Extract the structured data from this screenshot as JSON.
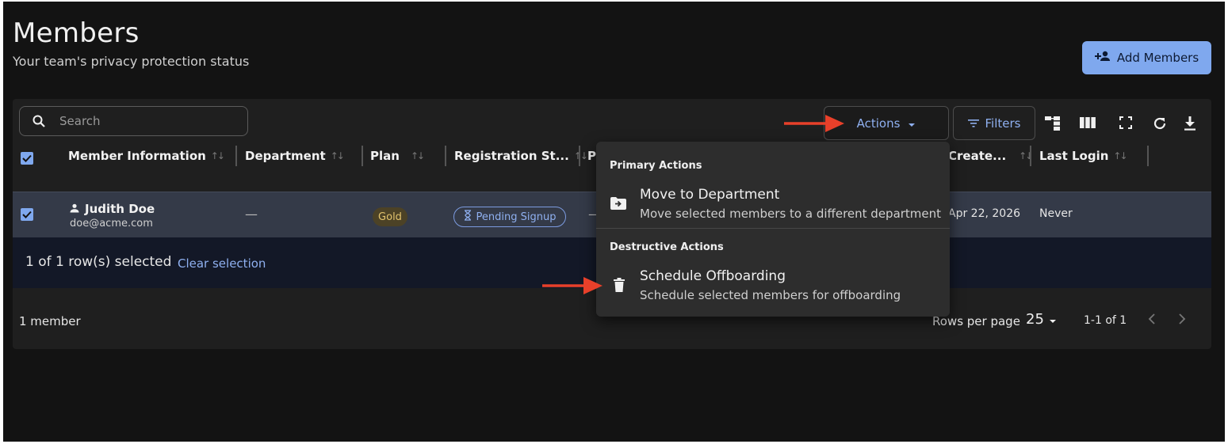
{
  "header": {
    "title": "Members",
    "subtitle": "Your team's privacy protection status",
    "add_button": "Add Members"
  },
  "toolbar": {
    "search_placeholder": "Search",
    "actions_label": "Actions",
    "filters_label": "Filters"
  },
  "columns": [
    "Member Information",
    "Department",
    "Plan",
    "Registration St...",
    "P",
    "Create...",
    "Last Login"
  ],
  "row": {
    "name": "Judith Doe",
    "email": "doe@acme.com",
    "department": "—",
    "plan": "Gold",
    "registration_status": "Pending Signup",
    "p_value": "—",
    "created": "Apr 22, 2026",
    "last_login": "Never",
    "selected": true
  },
  "selection": {
    "text": "1 of 1 row(s) selected",
    "clear_label": "Clear selection"
  },
  "footer": {
    "count_text": "1 member",
    "rows_per_page_label": "Rows per page",
    "rows_per_page_value": "25",
    "range_text": "1-1 of 1"
  },
  "actions_menu": {
    "primary_header": "Primary Actions",
    "move_title": "Move to Department",
    "move_desc": "Move selected members to a different department",
    "destructive_header": "Destructive Actions",
    "offboard_title": "Schedule Offboarding",
    "offboard_desc": "Schedule selected members for offboarding"
  },
  "colors": {
    "accent": "#7fa8ee",
    "annotation_arrow": "#e8402a",
    "gold_badge": "#e2c36d"
  }
}
